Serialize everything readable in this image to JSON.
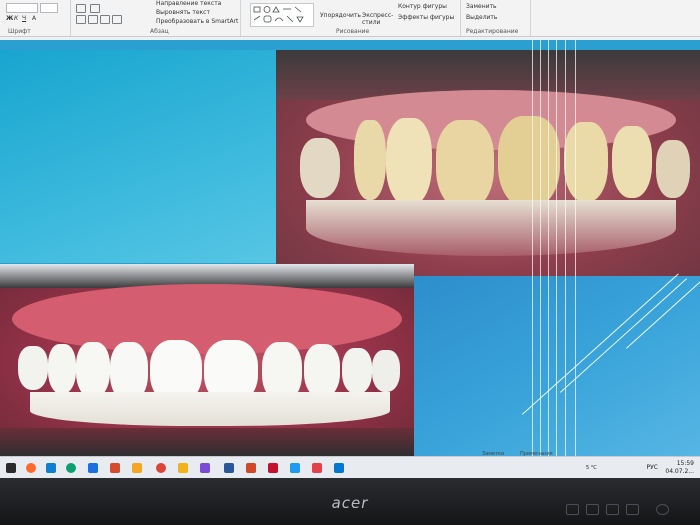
{
  "ribbon": {
    "font_group_label": "Шрифт",
    "paragraph_group_label": "Абзац",
    "drawing_group_label": "Рисование",
    "editing_group_label": "Редактирование",
    "text_direction": "Направление текста",
    "align_text": "Выровнять текст",
    "convert_smartart": "Преобразовать в SmartArt",
    "arrange": "Упорядочить",
    "quick_styles": "Экспресс-стили",
    "shape_outline": "Контур фигуры",
    "shape_effects": "Эффекты фигуры",
    "replace": "Заменить",
    "select": "Выделить"
  },
  "statusbar": {
    "notes": "Заметки",
    "comments": "Примечания"
  },
  "taskbar": {
    "weather": "5 °C",
    "language": "РУС",
    "time": "15:59",
    "date": "04.07.2..."
  },
  "monitor": {
    "brand": "acer"
  },
  "colors": {
    "slide_blue": "#2a9fd0",
    "ribbon_bg": "#f3f3f4",
    "taskbar_bg": "#e8ecf0",
    "bezel": "#1c1d20"
  },
  "icons": [
    "search-icon",
    "edge-icon",
    "chrome-icon",
    "word-icon",
    "powerpoint-icon",
    "explorer-icon"
  ]
}
